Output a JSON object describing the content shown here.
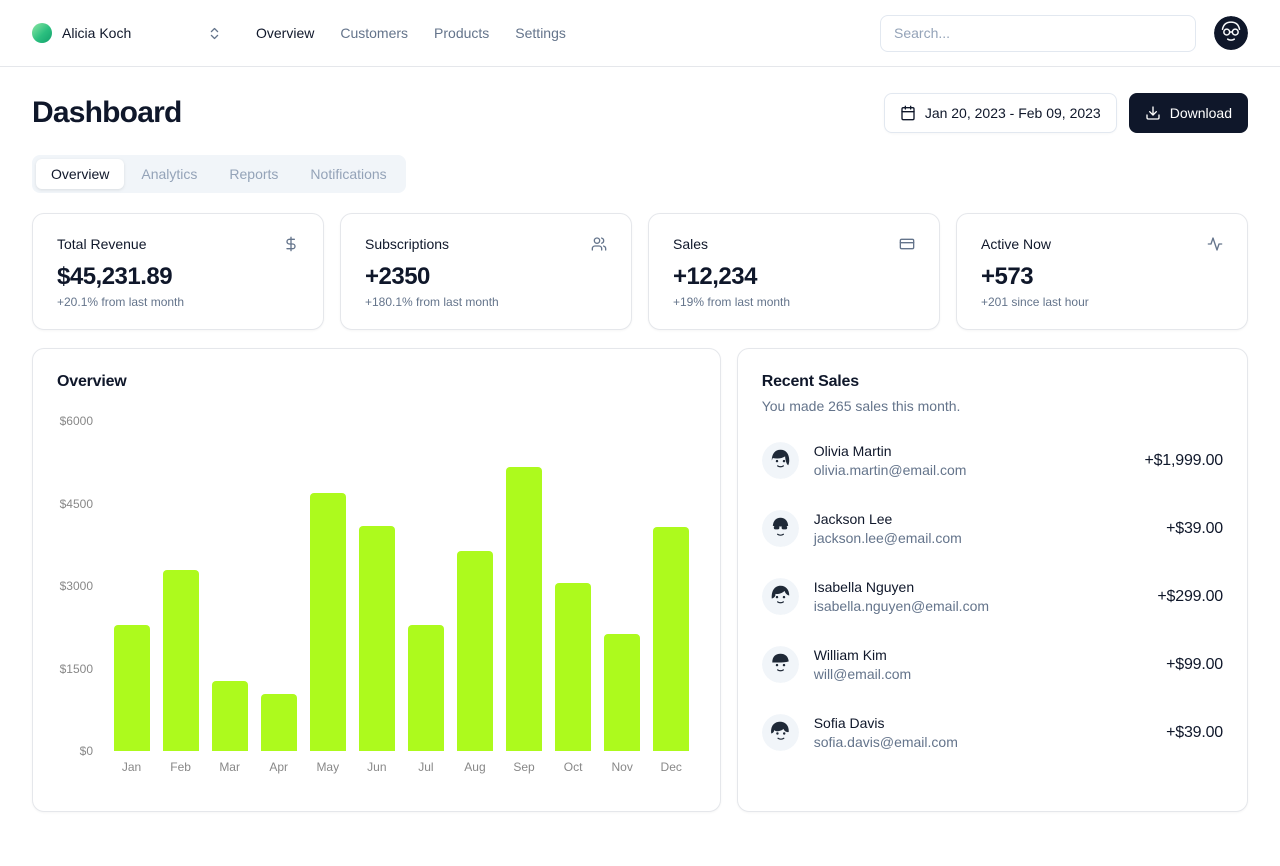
{
  "header": {
    "team_name": "Alicia Koch",
    "nav": [
      {
        "label": "Overview",
        "active": true
      },
      {
        "label": "Customers",
        "active": false
      },
      {
        "label": "Products",
        "active": false
      },
      {
        "label": "Settings",
        "active": false
      }
    ],
    "search": {
      "placeholder": "Search..."
    }
  },
  "page": {
    "title": "Dashboard",
    "date_range": "Jan 20, 2023 - Feb 09, 2023",
    "download_label": "Download"
  },
  "tabs": [
    {
      "label": "Overview",
      "active": true
    },
    {
      "label": "Analytics",
      "active": false
    },
    {
      "label": "Reports",
      "active": false
    },
    {
      "label": "Notifications",
      "active": false
    }
  ],
  "stats": [
    {
      "title": "Total Revenue",
      "icon": "dollar-icon",
      "value": "$45,231.89",
      "change": "+20.1% from last month"
    },
    {
      "title": "Subscriptions",
      "icon": "users-icon",
      "value": "+2350",
      "change": "+180.1% from last month"
    },
    {
      "title": "Sales",
      "icon": "credit-card-icon",
      "value": "+12,234",
      "change": "+19% from last month"
    },
    {
      "title": "Active Now",
      "icon": "activity-icon",
      "value": "+573",
      "change": "+201 since last hour"
    }
  ],
  "chart_data": {
    "type": "bar",
    "title": "Overview",
    "categories": [
      "Jan",
      "Feb",
      "Mar",
      "Apr",
      "May",
      "Jun",
      "Jul",
      "Aug",
      "Sep",
      "Oct",
      "Nov",
      "Dec"
    ],
    "values": [
      2300,
      3300,
      1280,
      1040,
      4700,
      4100,
      2300,
      3640,
      5160,
      3050,
      2120,
      4070
    ],
    "yticks": [
      "$6000",
      "$4500",
      "$3000",
      "$1500",
      "$0"
    ],
    "ylim": [
      0,
      6000
    ],
    "bar_color": "#adfa1d",
    "grid": false,
    "legend": false
  },
  "recent_sales": {
    "title": "Recent Sales",
    "subtitle": "You made 265 sales this month.",
    "items": [
      {
        "name": "Olivia Martin",
        "email": "olivia.martin@email.com",
        "amount": "+$1,999.00"
      },
      {
        "name": "Jackson Lee",
        "email": "jackson.lee@email.com",
        "amount": "+$39.00"
      },
      {
        "name": "Isabella Nguyen",
        "email": "isabella.nguyen@email.com",
        "amount": "+$299.00"
      },
      {
        "name": "William Kim",
        "email": "will@email.com",
        "amount": "+$99.00"
      },
      {
        "name": "Sofia Davis",
        "email": "sofia.davis@email.com",
        "amount": "+$39.00"
      }
    ]
  },
  "colors": {
    "accent_bar": "#adfa1d",
    "primary_dark": "#0f172a",
    "muted_text": "#64748b"
  }
}
